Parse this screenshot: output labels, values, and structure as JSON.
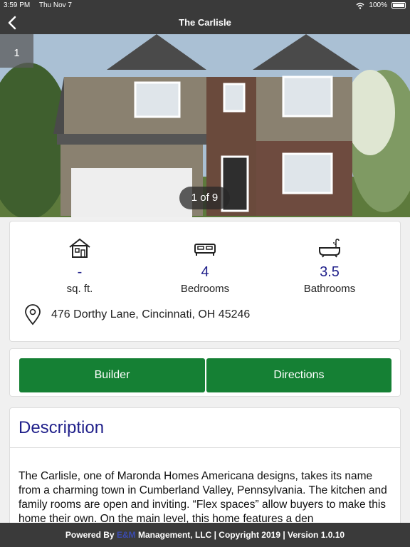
{
  "status": {
    "time": "3:59 PM",
    "date": "Thu Nov 7",
    "battery": "100%"
  },
  "nav": {
    "title": "The Carlisle"
  },
  "gallery": {
    "photo_number": "1",
    "counter": "1 of 9"
  },
  "stats": [
    {
      "icon": "house-icon",
      "value": "-",
      "label": "sq. ft."
    },
    {
      "icon": "bed-icon",
      "value": "4",
      "label": "Bedrooms"
    },
    {
      "icon": "bathtub-icon",
      "value": "3.5",
      "label": "Bathrooms"
    }
  ],
  "address": "476 Dorthy Lane, Cincinnati, OH 45246",
  "buttons": {
    "builder": "Builder",
    "directions": "Directions"
  },
  "description": {
    "title": "Description",
    "body": "The Carlisle, one of Maronda Homes Americana designs, takes its name from a charming town in Cumberland Valley, Pennsylvania. The kitchen and family rooms are open and inviting. “Flex spaces” allow buyers to make this home their own. On the main level, this home features a den"
  },
  "footer": {
    "prefix": "Powered By ",
    "brand": "E&M",
    "suffix": " Management, LLC | Copyright 2019 | Version 1.0.10"
  },
  "colors": {
    "accent_blue": "#1f1f8a",
    "button_green": "#158034",
    "bar_dark": "#3a3a3a"
  }
}
